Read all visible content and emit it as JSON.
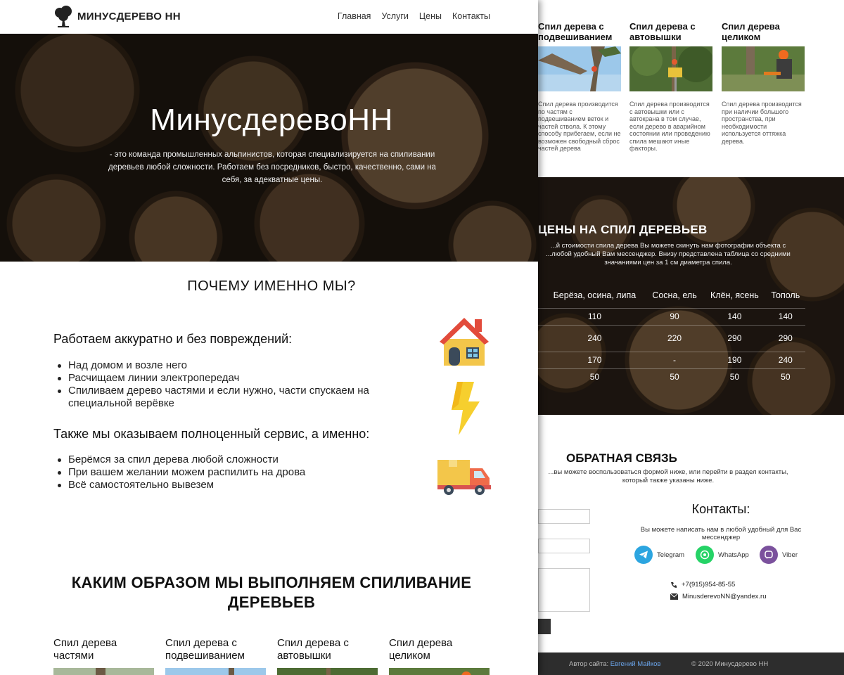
{
  "nav": {
    "brand": "МИНУСДЕРЕВО НН",
    "menu": [
      "Главная",
      "Услуги",
      "Цены",
      "Контакты"
    ]
  },
  "hero": {
    "title": "МинусдеревоНН",
    "text": "- это команда промышленных альпинистов, которая специализируется на спиливании деревьев любой сложности. Работаем без посредников, быстро, качественно, сами на себя, за адекватные цены."
  },
  "why": {
    "title": "ПОЧЕМУ ИМЕННО МЫ?",
    "block1_title": "Работаем аккуратно и без повреждений:",
    "block1_items": [
      "Над домом и возле него",
      "Расчищаем линии электропередач",
      "Спиливаем дерево частями и если нужно, части спускаем на специальной верёвке"
    ],
    "block2_title": "Также мы оказываем полноценный сервис, а именно:",
    "block2_items": [
      "Берёмся за спил дерева любой сложности",
      "При вашем желании можем распилить на дрова",
      "Всё самостоятельно вывезем"
    ],
    "icons": [
      "house-icon",
      "lightning-icon",
      "truck-icon"
    ]
  },
  "how": {
    "title": "КАКИМ ОБРАЗОМ МЫ ВЫПОЛНЯЕМ СПИЛИВАНИЕ ДЕРЕВЬЕВ",
    "cards": [
      "Спил дерева частями",
      "Спил дерева с подвешиванием",
      "Спил дерева с автовышки",
      "Спил дерева целиком"
    ]
  },
  "methods": [
    {
      "title": "Спил дерева с подвешиванием",
      "text": "Спил дерева производится по частям с подвешиванием веток и частей ствола. К этому способу прибегаем, если не возможен свободный сброс частей дерева"
    },
    {
      "title": "Спил дерева с автовышки",
      "text": "Спил дерева производится с автовышки или с автокрана в том случае, если дерево в аварийном состоянии или проведению спила мешают иные факторы."
    },
    {
      "title": "Спил дерева целиком",
      "text": "Спил дерева производится при наличии большого пространства, при необходимости используется оттяжка дерева."
    }
  ],
  "prices": {
    "title": "ЦЕНЫ НА СПИЛ ДЕРЕВЬЕВ",
    "text": "...й стоимости спила дерева Вы можете скинуть нам фотографии объекта с ...любой удобный Вам мессенджер. Внизу представлена таблица со средними значаниями цен за 1 см диаметра спила.",
    "columns": [
      "Берёза, осина, липа",
      "Сосна, ель",
      "Клён, ясень",
      "Тополь"
    ],
    "rows": [
      [
        "110",
        "90",
        "140",
        "140"
      ],
      [
        "240",
        "220",
        "290",
        "290"
      ],
      [
        "170",
        "-",
        "190",
        "240"
      ],
      [
        "50",
        "50",
        "50",
        "50"
      ]
    ]
  },
  "feedback": {
    "title": "ОБРАТНАЯ СВЯЗЬ",
    "text": "...вы можете воспользоваться формой ниже, или перейти в раздел контакты, который также указаны ниже."
  },
  "contacts": {
    "title": "Контакты:",
    "text": "Вы можете написать нам в любой удобный для Вас мессенджер",
    "messengers": [
      "Telegram",
      "WhatsApp",
      "Viber"
    ],
    "phone": "+7(915)954-85-55",
    "email": "MinusderevoNN@yandex.ru"
  },
  "footer": {
    "author_label": "Автор сайта:",
    "author_name": "Евгений Майков",
    "copyright": "© 2020 Минусдерево НН"
  },
  "colors": {
    "accent_link": "#6aa3e8",
    "telegram": "#2ca5e0",
    "whatsapp": "#25d366",
    "viber": "#7b519d",
    "footer_bg": "#2d2d2d"
  }
}
